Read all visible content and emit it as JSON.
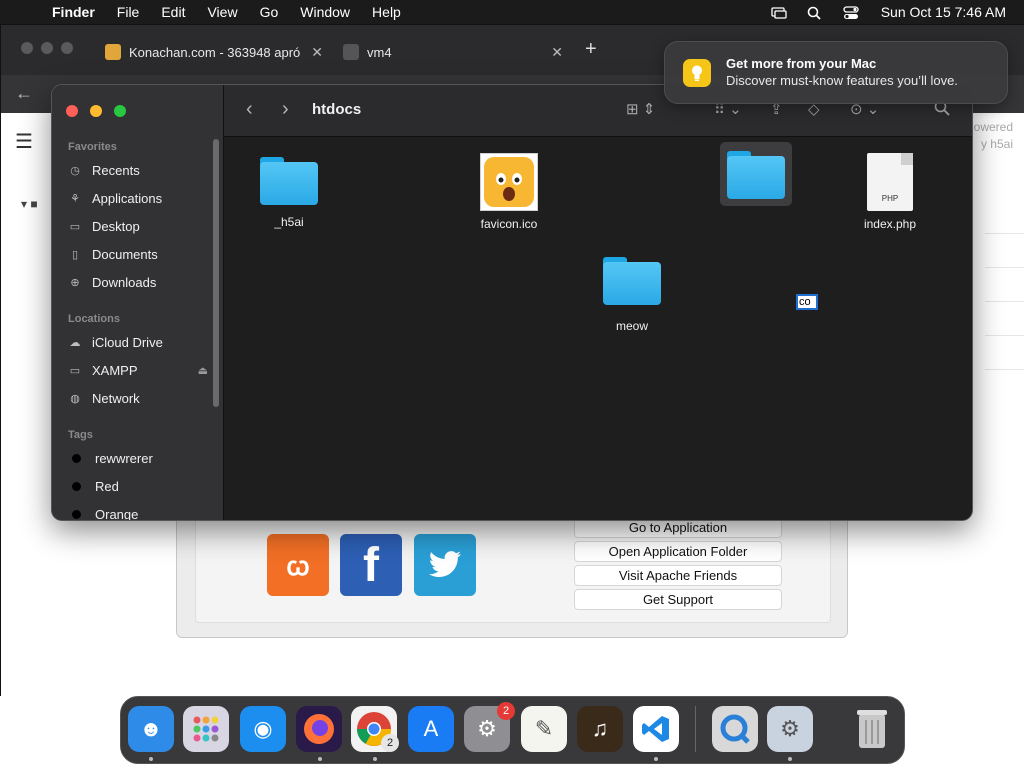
{
  "menubar": {
    "app": "Finder",
    "items": [
      "File",
      "Edit",
      "View",
      "Go",
      "Window",
      "Help"
    ],
    "clock": "Sun Oct 15  7:46 AM"
  },
  "browser": {
    "tabs": [
      {
        "title": "Konachan.com - 363948 apró"
      },
      {
        "title": "vm4"
      }
    ],
    "powered_line1": "owered",
    "powered_line2": "y h5ai"
  },
  "notification": {
    "title": "Get more from your Mac",
    "body": "Discover must-know features you’ll love."
  },
  "finder": {
    "title": "htdocs",
    "sidebar": {
      "favorites_heading": "Favorites",
      "favorites": [
        "Recents",
        "Applications",
        "Desktop",
        "Documents",
        "Downloads"
      ],
      "locations_heading": "Locations",
      "locations": [
        "iCloud Drive",
        "XAMPP",
        "Network"
      ],
      "tags_heading": "Tags",
      "tags": [
        "rewwrerer",
        "Red",
        "Orange"
      ]
    },
    "files": {
      "h5ai": "_h5ai",
      "favicon": "favicon.ico",
      "index": "index.php",
      "meow": "meow",
      "php_ext": "PHP",
      "rename_value": "co"
    }
  },
  "xampp": {
    "buttons": [
      "Go to Application",
      "Open Application Folder",
      "Visit Apache Friends",
      "Get Support"
    ]
  },
  "dock": {
    "settings_badge": "2",
    "chrome_badge": "2"
  }
}
